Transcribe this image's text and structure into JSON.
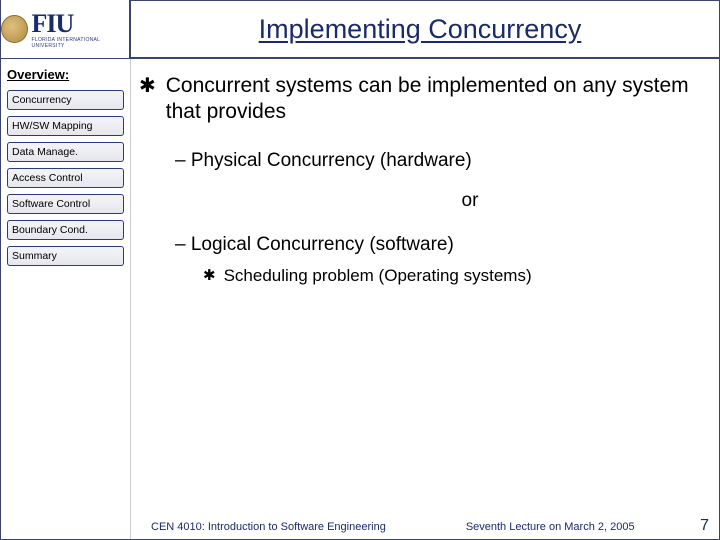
{
  "header": {
    "title": "Implementing Concurrency",
    "logo_text": "FIU",
    "logo_sub": "FLORIDA INTERNATIONAL UNIVERSITY"
  },
  "sidebar": {
    "label": "Overview:",
    "items": [
      {
        "label": "Concurrency"
      },
      {
        "label": "HW/SW Mapping"
      },
      {
        "label": "Data Manage."
      },
      {
        "label": "Access Control"
      },
      {
        "label": "Software Control"
      },
      {
        "label": "Boundary Cond."
      },
      {
        "label": "Summary"
      }
    ]
  },
  "content": {
    "bullet0": "Concurrent systems can be implemented on any system that provides",
    "sub1": "Physical Concurrency (hardware)",
    "or": "or",
    "sub2": "Logical Concurrency (software)",
    "sub2a": "Scheduling problem (Operating systems)"
  },
  "footer": {
    "course": "CEN 4010: Introduction to Software Engineering",
    "lecture": "Seventh Lecture on March 2, 2005",
    "page": "7"
  }
}
